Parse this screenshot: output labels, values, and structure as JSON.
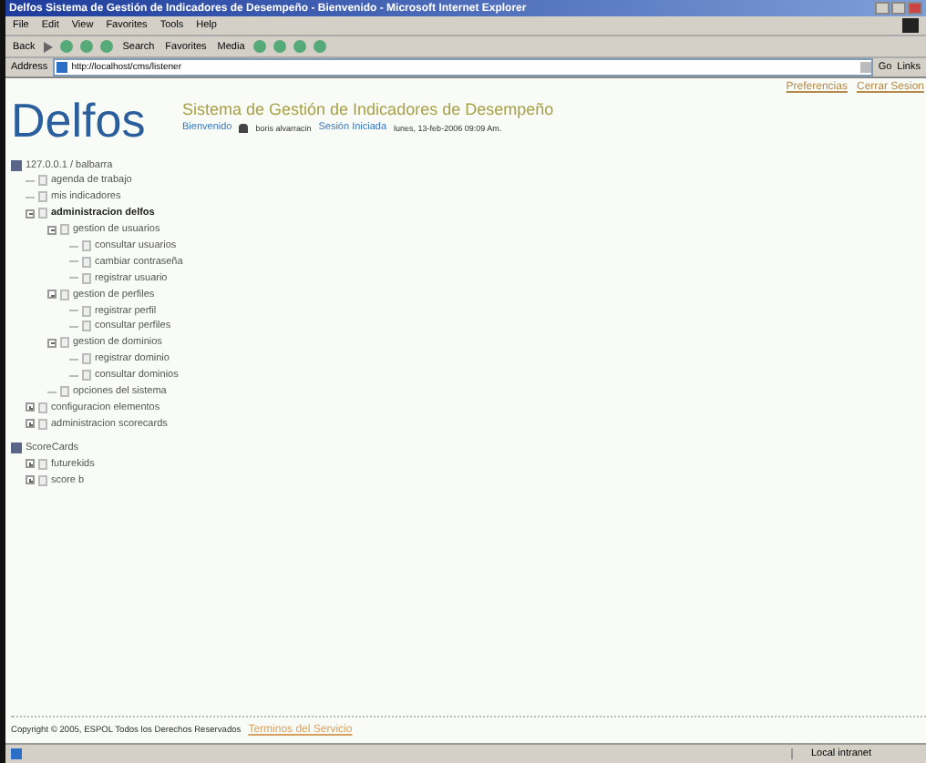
{
  "window": {
    "title": "Delfos Sistema de Gestión de Indicadores de Desempeño - Bienvenido - Microsoft Internet Explorer"
  },
  "menu": [
    "File",
    "Edit",
    "View",
    "Favorites",
    "Tools",
    "Help"
  ],
  "toolbar": [
    "Back",
    "Search",
    "Favorites",
    "Media"
  ],
  "address": {
    "label": "Address",
    "value": "http://localhost/cms/listener",
    "go": "Go",
    "links": "Links"
  },
  "header": {
    "logo": "Delfos",
    "system_title": "Sistema de Gestión de Indicadores de Desempeño",
    "welcome": "Bienvenido",
    "user": "boris alvarracin",
    "session": "Sesión Iniciada",
    "date": "lunes, 13-feb-2006 09:09 Am.",
    "links": [
      "Preferencias",
      "Cerrar Sesion"
    ]
  },
  "trees": [
    {
      "label": "127.0.0.1 / balbarra",
      "children": [
        {
          "label": "agenda de trabajo",
          "kind": "leaf",
          "selected": false
        },
        {
          "label": "mis indicadores",
          "kind": "leaf",
          "selected": false
        },
        {
          "label": "administracion delfos",
          "kind": "folder",
          "expanded": true,
          "selected": true,
          "children": [
            {
              "label": "gestion de usuarios",
              "kind": "folder",
              "expanded": true,
              "selected": false,
              "children": [
                {
                  "label": "consultar usuarios",
                  "kind": "leaf",
                  "selected": false
                },
                {
                  "label": "cambiar contraseña",
                  "kind": "leaf",
                  "selected": false
                },
                {
                  "label": "registrar usuario",
                  "kind": "leaf",
                  "selected": false
                }
              ]
            },
            {
              "label": "gestion de perfiles",
              "kind": "folder",
              "expanded": true,
              "selected": false,
              "children": [
                {
                  "label": "registrar perfil",
                  "kind": "leaf",
                  "selected": false
                },
                {
                  "label": "consultar perfiles",
                  "kind": "leaf",
                  "selected": false
                }
              ]
            },
            {
              "label": "gestion de dominios",
              "kind": "folder",
              "expanded": true,
              "selected": false,
              "children": [
                {
                  "label": "registrar dominio",
                  "kind": "leaf",
                  "selected": false
                },
                {
                  "label": "consultar dominios",
                  "kind": "leaf",
                  "selected": false
                }
              ]
            },
            {
              "label": "opciones del sistema",
              "kind": "leaf",
              "selected": false
            }
          ]
        },
        {
          "label": "configuracion elementos",
          "kind": "folder",
          "expanded": false,
          "selected": false
        },
        {
          "label": "administracion scorecards",
          "kind": "folder",
          "expanded": false,
          "selected": false
        }
      ]
    },
    {
      "label": "ScoreCards",
      "children": [
        {
          "label": "futurekids",
          "kind": "folder",
          "expanded": false,
          "selected": false
        },
        {
          "label": "score b",
          "kind": "folder",
          "expanded": false,
          "selected": false
        }
      ]
    }
  ],
  "footer": {
    "copyright": "Copyright © 2005, ESPOL Todos los Derechos Reservados",
    "link": "Terminos del Servicio"
  },
  "status_bar": {
    "zone": "Local intranet"
  }
}
